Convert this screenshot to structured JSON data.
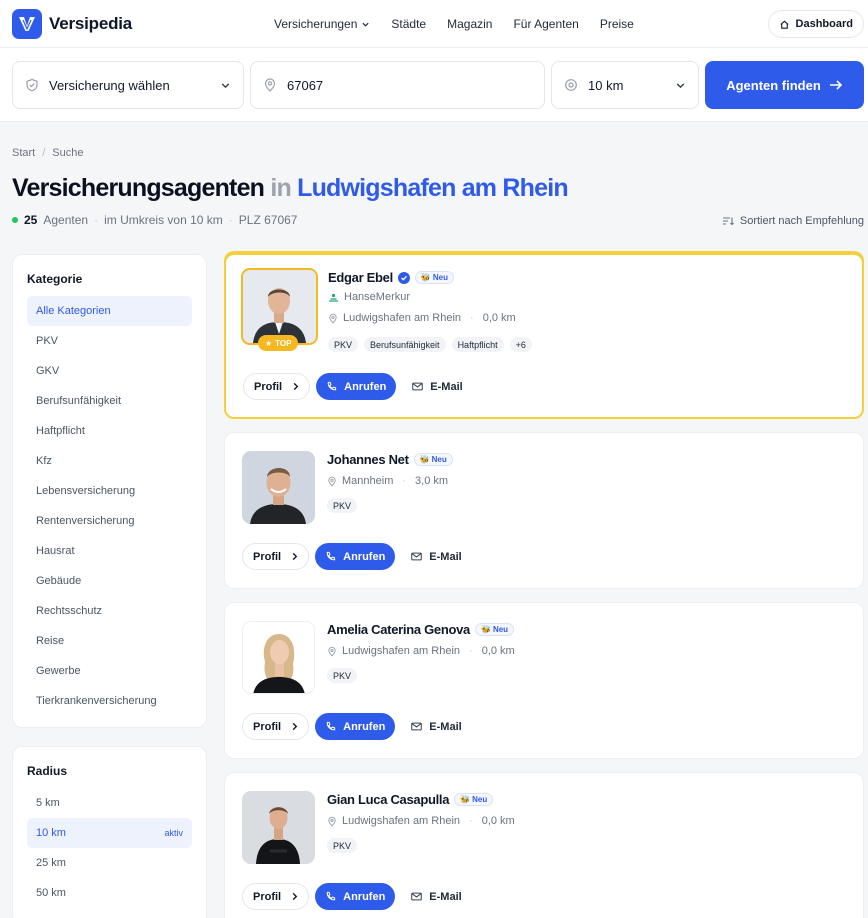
{
  "brand": {
    "name": "Versipedia"
  },
  "nav": {
    "links": [
      "Versicherungen",
      "Städte",
      "Magazin",
      "Für Agenten",
      "Preise"
    ],
    "dashboard": "Dashboard"
  },
  "search": {
    "insurance_placeholder": "Versicherung wählen",
    "plz": "67067",
    "radius": "10 km",
    "button": "Agenten finden"
  },
  "breadcrumb": {
    "home": "Start",
    "sep": "/",
    "current": "Suche"
  },
  "heading": {
    "title_main": "Versicherungsagenten",
    "title_in": "in",
    "title_city": "Ludwigshafen am Rhein",
    "count": "25",
    "count_label": "Agenten",
    "radius_text": "im Umkreis von 10 km",
    "plz_text": "PLZ 67067",
    "sep": "·",
    "sort": "Sortiert nach Empfehlung"
  },
  "sidebar": {
    "category_title": "Kategorie",
    "categories": [
      "Alle Kategorien",
      "PKV",
      "GKV",
      "Berufsunfähigkeit",
      "Haftpflicht",
      "Kfz",
      "Lebensversicherung",
      "Rentenversicherung",
      "Hausrat",
      "Gebäude",
      "Rechtsschutz",
      "Reise",
      "Gewerbe",
      "Tierkrankenversicherung"
    ],
    "radius_title": "Radius",
    "radius_options": [
      "5 km",
      "10 km",
      "25 km",
      "50 km"
    ],
    "radius_active_label": "aktiv"
  },
  "labels": {
    "profile": "Profil",
    "call": "Anrufen",
    "email": "E-Mail",
    "new": "Neu",
    "top": "TOP"
  },
  "agents": [
    {
      "name": "Edgar Ebel",
      "company": "HanseMerkur",
      "city": "Ludwigshafen am Rhein",
      "distance": "0,0 km",
      "tags": [
        "PKV",
        "Berufsunfähigkeit",
        "Haftpflicht",
        "+6"
      ]
    },
    {
      "name": "Johannes Net",
      "city": "Mannheim",
      "distance": "3,0 km",
      "tags": [
        "PKV"
      ]
    },
    {
      "name": "Amelia Caterina Genova",
      "city": "Ludwigshafen am Rhein",
      "distance": "0,0 km",
      "tags": [
        "PKV"
      ]
    },
    {
      "name": "Gian Luca Casapulla",
      "city": "Ludwigshafen am Rhein",
      "distance": "0,0 km",
      "tags": [
        "PKV"
      ]
    }
  ],
  "colors": {
    "accent": "#2f5bea",
    "top_gold": "#f5b820",
    "status_green": "#22c55e"
  }
}
